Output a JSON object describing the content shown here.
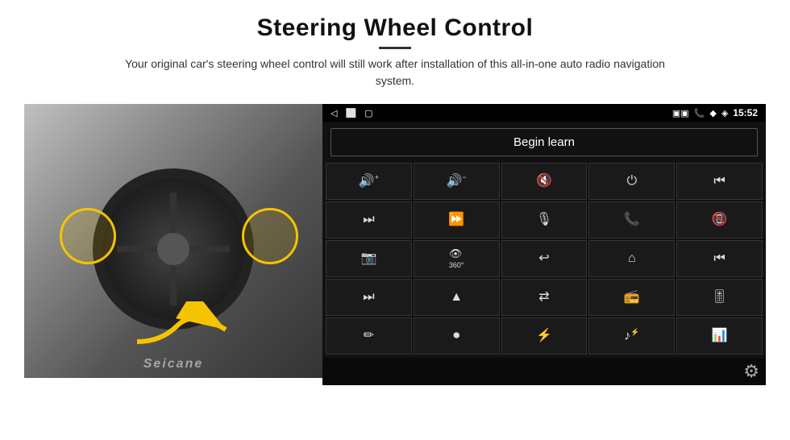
{
  "page": {
    "title": "Steering Wheel Control",
    "subtitle": "Your original car's steering wheel control will still work after installation of this all-in-one auto radio navigation system.",
    "divider": true
  },
  "status_bar": {
    "left_icons": [
      "◁",
      "⬜",
      "▢"
    ],
    "signal_icons": [
      "▣",
      "▣"
    ],
    "right_icons": [
      "📞",
      "◆",
      "WiFi"
    ],
    "time": "15:52"
  },
  "begin_learn": {
    "label": "Begin learn"
  },
  "controls": [
    {
      "id": "vol-up",
      "icon": "🔊+",
      "sym": "vol_up"
    },
    {
      "id": "vol-down",
      "icon": "🔊−",
      "sym": "vol_down"
    },
    {
      "id": "vol-mute",
      "icon": "🔇",
      "sym": "vol_mute"
    },
    {
      "id": "power",
      "icon": "⏻",
      "sym": "power"
    },
    {
      "id": "prev-track",
      "icon": "⏮",
      "sym": "prev_track"
    },
    {
      "id": "next",
      "icon": "⏭",
      "sym": "next"
    },
    {
      "id": "seek-fwd",
      "icon": "⏩",
      "sym": "seek_fwd"
    },
    {
      "id": "mic",
      "icon": "🎙",
      "sym": "mic"
    },
    {
      "id": "phone",
      "icon": "📞",
      "sym": "phone"
    },
    {
      "id": "hang-up",
      "icon": "📵",
      "sym": "hang_up"
    },
    {
      "id": "cam",
      "icon": "📷",
      "sym": "cam"
    },
    {
      "id": "360",
      "icon": "👁360",
      "sym": "view360"
    },
    {
      "id": "back",
      "icon": "↩",
      "sym": "back"
    },
    {
      "id": "home",
      "icon": "⌂",
      "sym": "home"
    },
    {
      "id": "skip-back",
      "icon": "⏮",
      "sym": "skip_back"
    },
    {
      "id": "skip-fwd",
      "icon": "⏭",
      "sym": "skip_fwd2"
    },
    {
      "id": "nav",
      "icon": "▲",
      "sym": "nav"
    },
    {
      "id": "swap",
      "icon": "⇄",
      "sym": "swap"
    },
    {
      "id": "radio",
      "icon": "📻",
      "sym": "radio"
    },
    {
      "id": "eq",
      "icon": "🎚",
      "sym": "eq"
    },
    {
      "id": "pen",
      "icon": "✏",
      "sym": "pen"
    },
    {
      "id": "record",
      "icon": "⏺",
      "sym": "record"
    },
    {
      "id": "bt",
      "icon": "⚡",
      "sym": "bluetooth"
    },
    {
      "id": "music",
      "icon": "♪",
      "sym": "music"
    },
    {
      "id": "spectrum",
      "icon": "📊",
      "sym": "spectrum"
    }
  ],
  "watermark": "Seicane",
  "bottom": {
    "gear_icon": "⚙"
  }
}
